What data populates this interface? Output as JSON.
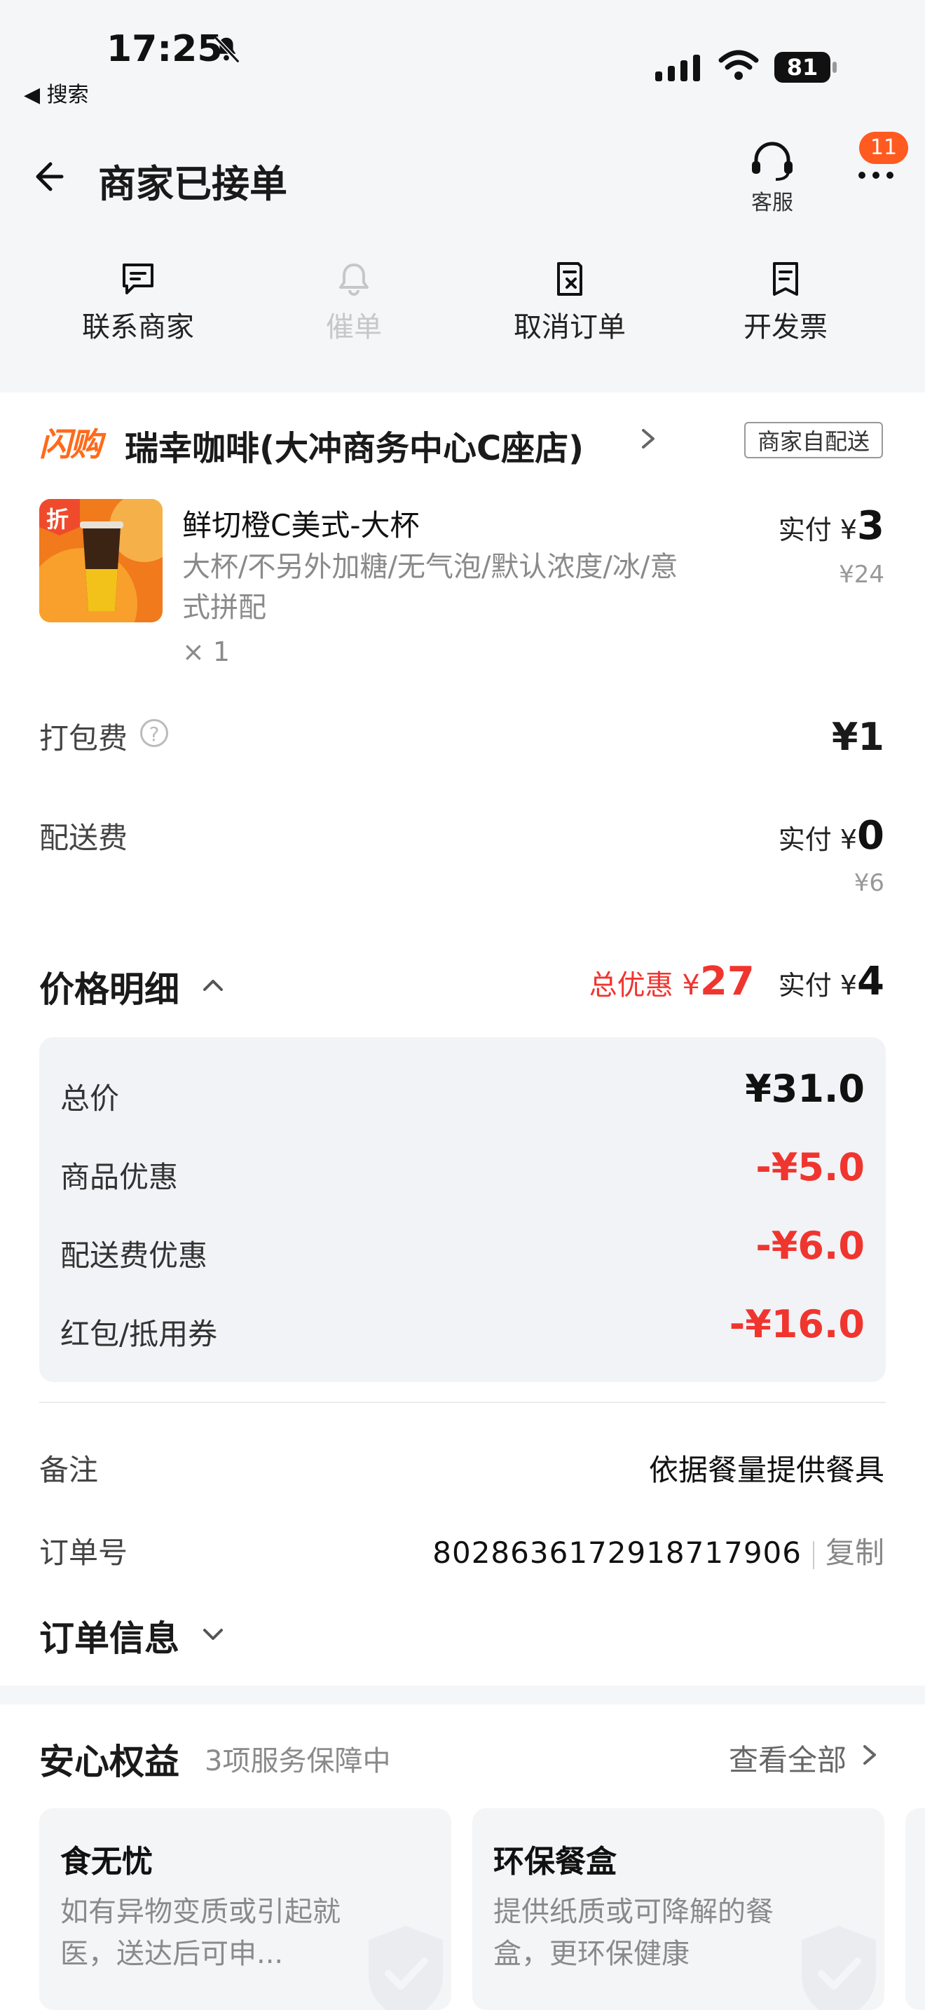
{
  "status_bar": {
    "time": "17:25",
    "back_label": "◀ 搜索",
    "battery": "81"
  },
  "header": {
    "title": "商家已接单",
    "service_label": "客服",
    "badge": "11"
  },
  "actions": [
    {
      "label": "联系商家",
      "enabled": true,
      "icon": "chat-icon"
    },
    {
      "label": "催单",
      "enabled": false,
      "icon": "bell-icon"
    },
    {
      "label": "取消订单",
      "enabled": true,
      "icon": "cancel-order-icon"
    },
    {
      "label": "开发票",
      "enabled": true,
      "icon": "invoice-icon"
    }
  ],
  "store": {
    "brand": "闪购",
    "name": "瑞幸咖啡(大冲商务中心C座店)",
    "delivery_tag": "商家自配送"
  },
  "item": {
    "discount_badge": "折",
    "name": "鲜切橙C美式-大杯",
    "spec_line1": "大杯/不另外加糖/无气泡/默认浓度/冰/意",
    "spec_line2": "式拼配",
    "qty": "× 1",
    "paid_label": "实付 ¥",
    "paid": "3",
    "original": "¥24"
  },
  "packing": {
    "label": "打包费",
    "help": "?",
    "value": "¥1"
  },
  "delivery": {
    "label": "配送费",
    "paid_label": "实付 ¥",
    "paid": "0",
    "original": "¥6"
  },
  "price_detail": {
    "title": "价格明细",
    "total_discount_label": "总优惠 ¥",
    "total_discount": "27",
    "paid_label": "实付 ¥",
    "paid": "4",
    "rows": [
      {
        "label": "总价",
        "value": "¥31.0"
      },
      {
        "label": "商品优惠",
        "value": "-¥5.0"
      },
      {
        "label": "配送费优惠",
        "value": "-¥6.0"
      },
      {
        "label": "红包/抵用券",
        "value": "-¥16.0"
      }
    ]
  },
  "remark": {
    "label": "备注",
    "value": "依据餐量提供餐具"
  },
  "order_no": {
    "label": "订单号",
    "value": "8028636172918717906",
    "copy": "复制"
  },
  "order_info": {
    "title": "订单信息"
  },
  "guarantee": {
    "title": "安心权益",
    "subtitle": "3项服务保障中",
    "view_all": "查看全部",
    "cards": [
      {
        "title": "食无忧",
        "desc": "如有异物变质或引起就医，送达后可申..."
      },
      {
        "title": "环保餐盒",
        "desc": "提供纸质或可降解的餐盒，更环保健康"
      }
    ]
  },
  "colors": {
    "accent_red": "#f0352f",
    "brand_orange": "#ff6a1a",
    "badge_orange": "#ff5a1f"
  }
}
